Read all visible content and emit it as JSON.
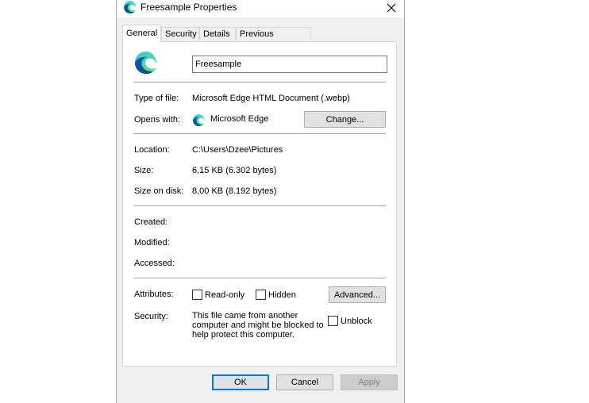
{
  "window": {
    "title": "Freesample Properties",
    "close_glyph": "✕"
  },
  "tabs": [
    {
      "label": "General",
      "active": true
    },
    {
      "label": "Security",
      "active": false
    },
    {
      "label": "Details",
      "active": false
    },
    {
      "label": "Previous Versions",
      "active": false
    }
  ],
  "general": {
    "file_name": "Freesample",
    "type_label": "Type of file:",
    "type_value": "Microsoft Edge HTML Document (.webp)",
    "opens_label": "Opens with:",
    "opens_value": "Microsoft Edge",
    "change_button": "Change...",
    "location_label": "Location:",
    "location_value": "C:\\Users\\Dzee\\Pictures",
    "size_label": "Size:",
    "size_value": "6,15 KB (6.302 bytes)",
    "size_disk_label": "Size on disk:",
    "size_disk_value": "8,00 KB (8.192 bytes)",
    "created_label": "Created:",
    "modified_label": "Modified:",
    "accessed_label": "Accessed:",
    "attributes_label": "Attributes:",
    "readonly_label": "Read-only",
    "hidden_label": "Hidden",
    "advanced_button": "Advanced...",
    "security_label": "Security:",
    "security_text": "This file came from another computer and might be blocked to help protect this computer.",
    "unblock_label": "Unblock"
  },
  "footer": {
    "ok": "OK",
    "cancel": "Cancel",
    "apply": "Apply"
  },
  "icons": {
    "app": "microsoft-edge-icon",
    "close": "close-icon"
  },
  "colors": {
    "accent": "#0078d7",
    "edge_teal": "#2ecc71",
    "edge_blue": "#0c59a4"
  }
}
